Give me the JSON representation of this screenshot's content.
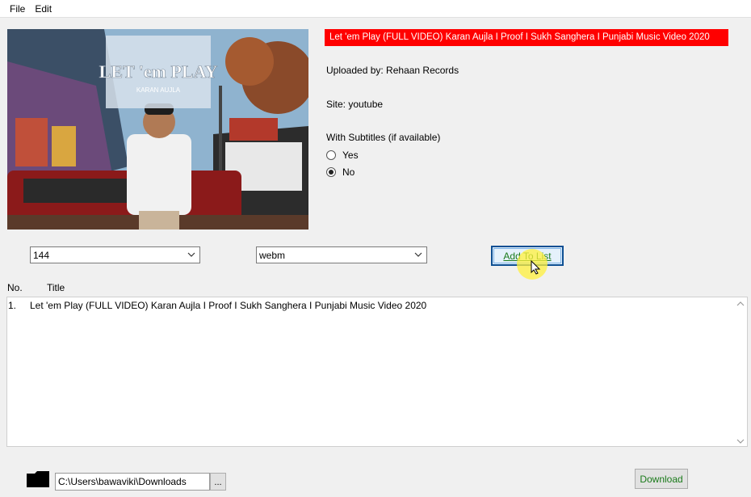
{
  "menu": {
    "file": "File",
    "edit": "Edit"
  },
  "thumbnail": {
    "text_main": "LET 'em PLAY",
    "text_sub": "KARAN AUJLA"
  },
  "video": {
    "title": "Let 'em Play (FULL VIDEO) Karan Aujla I Proof I Sukh Sanghera I Punjabi Music Video 2020",
    "uploaded_by": "Uploaded by: Rehaan Records",
    "site": "Site: youtube",
    "subtitles_label": "With Subtitles (if available)",
    "subtitle_options": [
      {
        "label": "Yes",
        "selected": false
      },
      {
        "label": "No",
        "selected": true
      }
    ]
  },
  "controls": {
    "quality_value": "144",
    "format_value": "webm",
    "add_label": "Add To List"
  },
  "list": {
    "headers": {
      "no": "No.",
      "title": "Title"
    },
    "rows": [
      {
        "no": "1.",
        "title": "Let 'em Play (FULL VIDEO) Karan Aujla I Proof I Sukh Sanghera I Punjabi Music Video 2020"
      }
    ]
  },
  "footer": {
    "path_value": "C:\\Users\\bawaviki\\Downloads",
    "browse_label": "...",
    "download_label": "Download"
  },
  "colors": {
    "title_bg": "#ff0000",
    "accent_border": "#0d4f93",
    "button_text": "#1a7a1a"
  },
  "icons": {
    "folder": "folder-icon",
    "cursor": "mouse-pointer-icon",
    "dropdown": "chevron-down-icon"
  }
}
